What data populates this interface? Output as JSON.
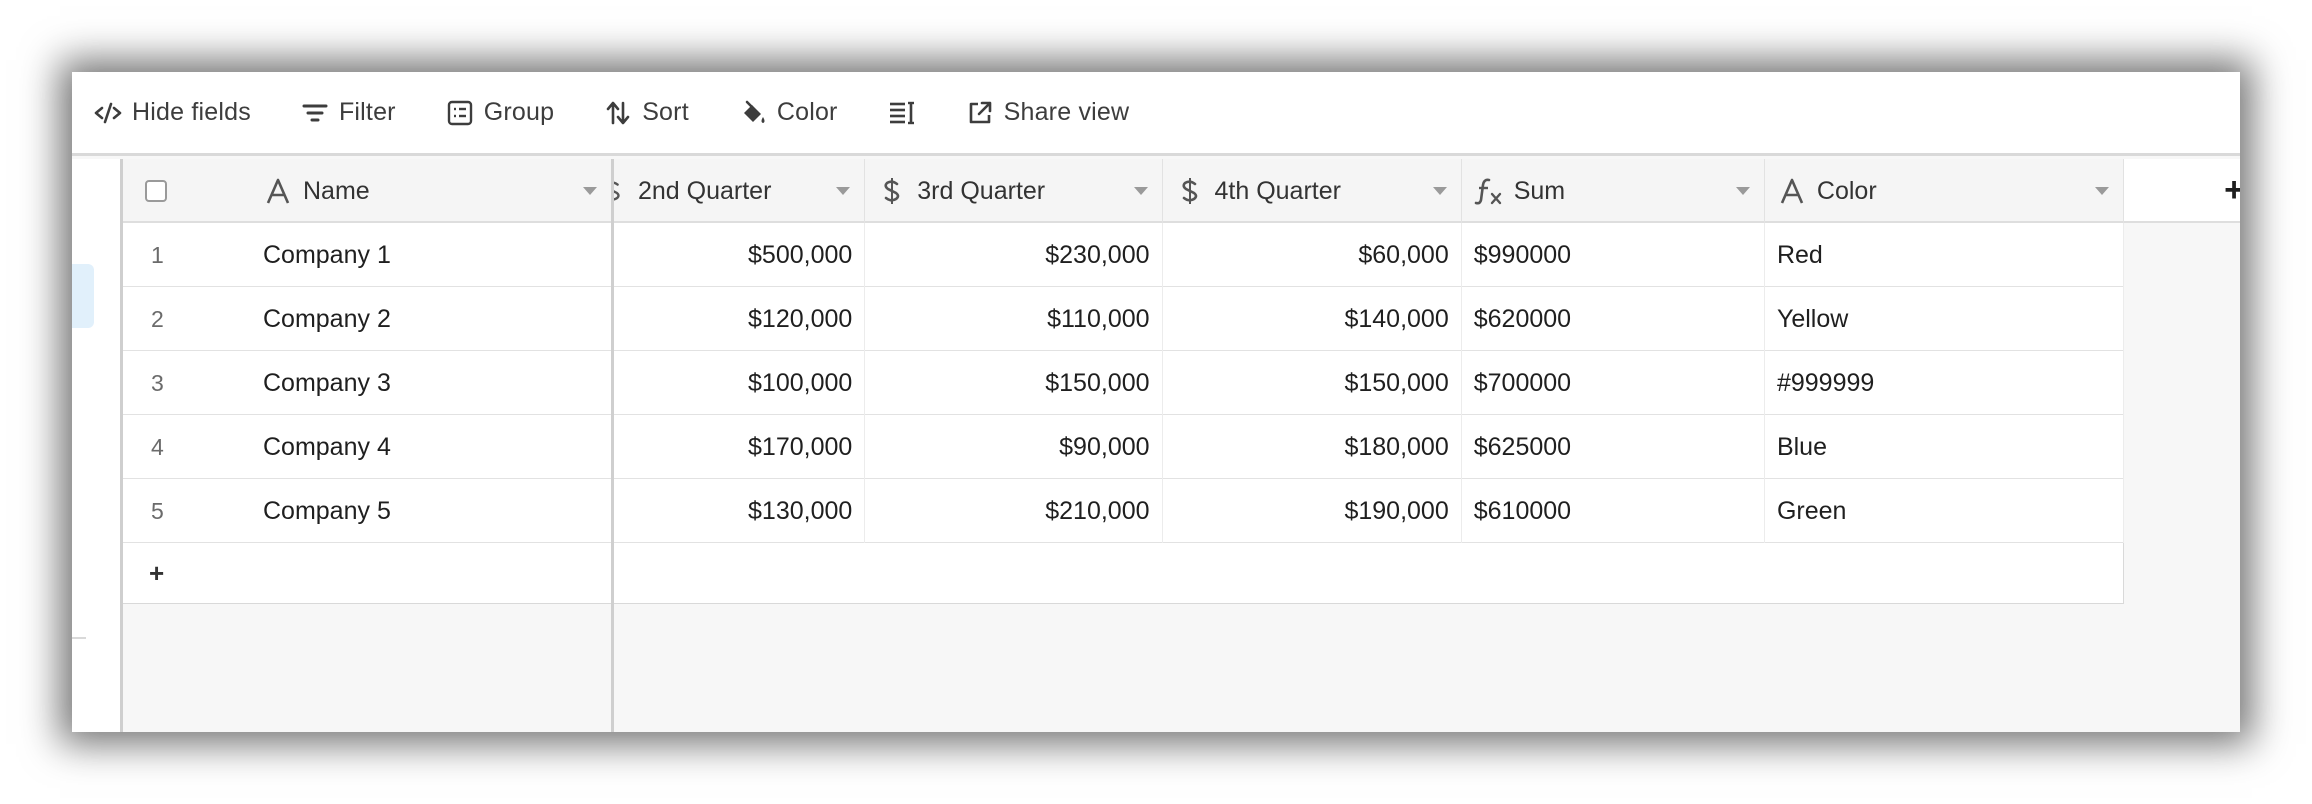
{
  "toolbar": {
    "hide_fields": "Hide fields",
    "filter": "Filter",
    "group": "Group",
    "sort": "Sort",
    "color": "Color",
    "share_view": "Share view"
  },
  "columns": {
    "name": "Name",
    "q2": "2nd Quarter",
    "q3": "3rd Quarter",
    "q4": "4th Quarter",
    "sum": "Sum",
    "color": "Color"
  },
  "rows": [
    {
      "num": "1",
      "name": "Company 1",
      "q2": "$500,000",
      "q3": "$230,000",
      "q4": "$60,000",
      "sum": "$990000",
      "color": "Red"
    },
    {
      "num": "2",
      "name": "Company 2",
      "q2": "$120,000",
      "q3": "$110,000",
      "q4": "$140,000",
      "sum": "$620000",
      "color": "Yellow"
    },
    {
      "num": "3",
      "name": "Company 3",
      "q2": "$100,000",
      "q3": "$150,000",
      "q4": "$150,000",
      "sum": "$700000",
      "color": "#999999"
    },
    {
      "num": "4",
      "name": "Company 4",
      "q2": "$170,000",
      "q3": "$90,000",
      "q4": "$180,000",
      "sum": "$625000",
      "color": "Blue"
    },
    {
      "num": "5",
      "name": "Company 5",
      "q2": "$130,000",
      "q3": "$210,000",
      "q4": "$190,000",
      "sum": "$610000",
      "color": "Green"
    }
  ],
  "add_row": "+",
  "add_column": "+",
  "icons": {
    "hide_fields": "eye-slash-icon",
    "filter": "filter-icon",
    "group": "group-icon",
    "sort": "sort-icon",
    "color": "paint-bucket-icon",
    "row_height": "row-height-icon",
    "share_view": "share-icon",
    "text_field": "text-field-icon",
    "currency_field": "currency-icon",
    "formula_field": "formula-icon"
  },
  "colors": {
    "accent": "#e1f0fb",
    "header_bg": "#f5f5f5",
    "grid_bg": "#f7f7f7"
  }
}
